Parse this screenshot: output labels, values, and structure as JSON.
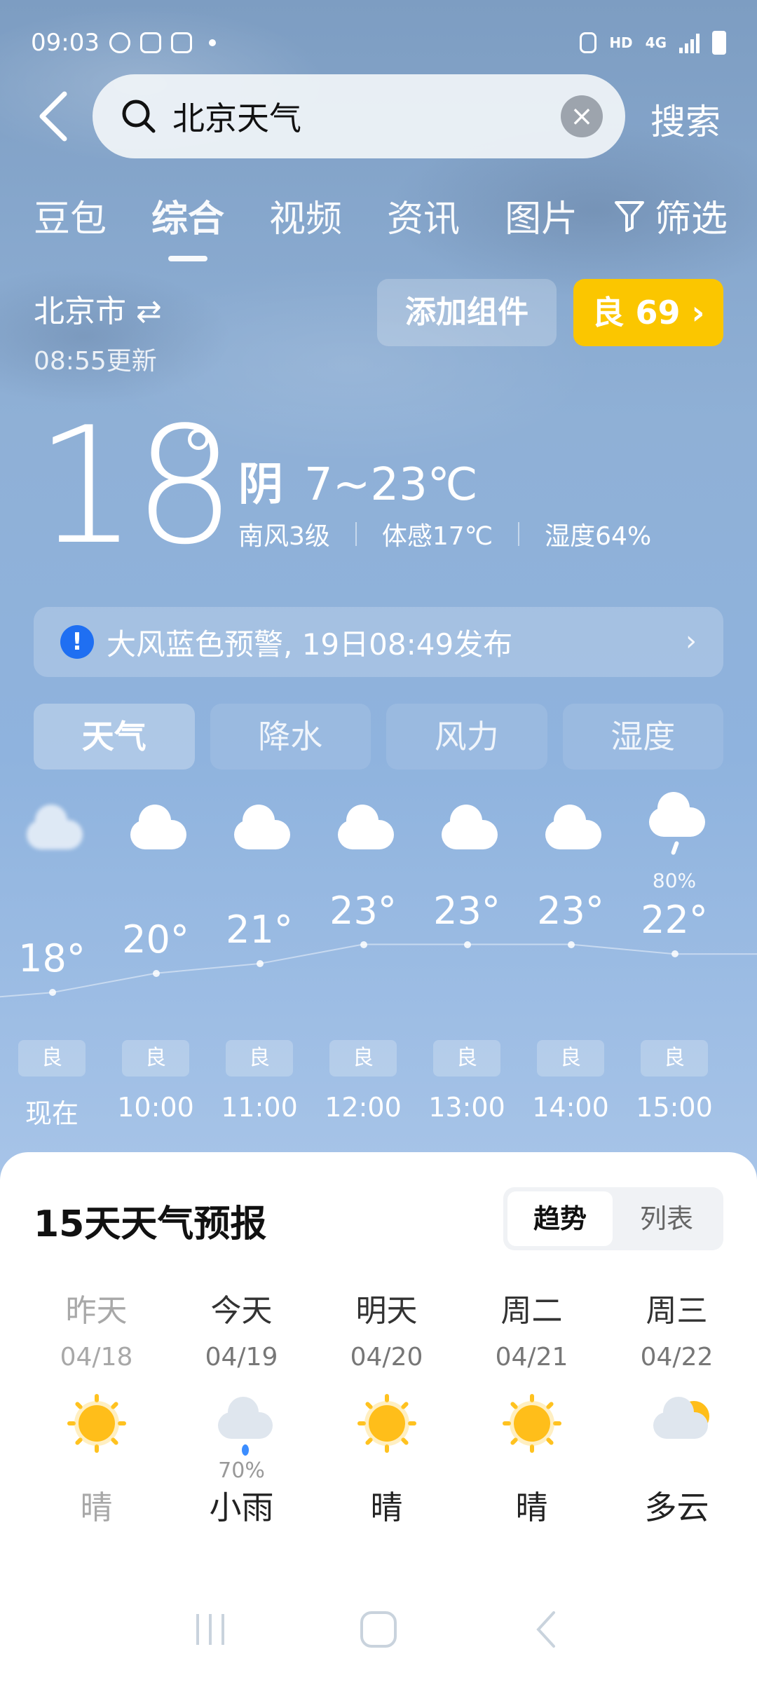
{
  "status_bar": {
    "time": "09:03",
    "hd": "HD",
    "network": "4G"
  },
  "search": {
    "query": "北京天气",
    "button": "搜索"
  },
  "tabs": [
    "豆包",
    "综合",
    "视频",
    "资讯",
    "图片"
  ],
  "filter_label": "筛选",
  "location": {
    "city": "北京市",
    "updated": "08:55更新"
  },
  "add_widget_label": "添加组件",
  "aqi": {
    "label": "良 69 ›",
    "color": "#FBC600"
  },
  "current": {
    "temp": "18",
    "condition": "阴",
    "range": "7~23℃",
    "wind": "南风3级",
    "feels": "体感17℃",
    "humidity": "湿度64%"
  },
  "alert": {
    "text": "大风蓝色预警, 19日08:49发布"
  },
  "segments": [
    "天气",
    "降水",
    "风力",
    "湿度"
  ],
  "hourly": [
    {
      "time": "现在",
      "temp": "18°",
      "aqi": "良",
      "icon": "cloudy-icon",
      "precip": ""
    },
    {
      "time": "10:00",
      "temp": "20°",
      "aqi": "良",
      "icon": "cloudy-icon",
      "precip": ""
    },
    {
      "time": "11:00",
      "temp": "21°",
      "aqi": "良",
      "icon": "cloudy-icon",
      "precip": ""
    },
    {
      "time": "12:00",
      "temp": "23°",
      "aqi": "良",
      "icon": "cloudy-icon",
      "precip": ""
    },
    {
      "time": "13:00",
      "temp": "23°",
      "aqi": "良",
      "icon": "cloudy-icon",
      "precip": ""
    },
    {
      "time": "14:00",
      "temp": "23°",
      "aqi": "良",
      "icon": "cloudy-icon",
      "precip": ""
    },
    {
      "time": "15:00",
      "temp": "22°",
      "aqi": "良",
      "icon": "light-rain-icon",
      "precip": "80%"
    }
  ],
  "forecast": {
    "title": "15天天气预报",
    "toggle": [
      "趋势",
      "列表"
    ],
    "days": [
      {
        "name": "昨天",
        "date": "04/18",
        "cond": "晴",
        "icon": "sunny-icon",
        "precip": ""
      },
      {
        "name": "今天",
        "date": "04/19",
        "cond": "小雨",
        "icon": "light-rain-icon",
        "precip": "70%"
      },
      {
        "name": "明天",
        "date": "04/20",
        "cond": "晴",
        "icon": "sunny-icon",
        "precip": ""
      },
      {
        "name": "周二",
        "date": "04/21",
        "cond": "晴",
        "icon": "sunny-icon",
        "precip": ""
      },
      {
        "name": "周三",
        "date": "04/22",
        "cond": "多云",
        "icon": "partly-cloudy-icon",
        "precip": ""
      }
    ]
  }
}
